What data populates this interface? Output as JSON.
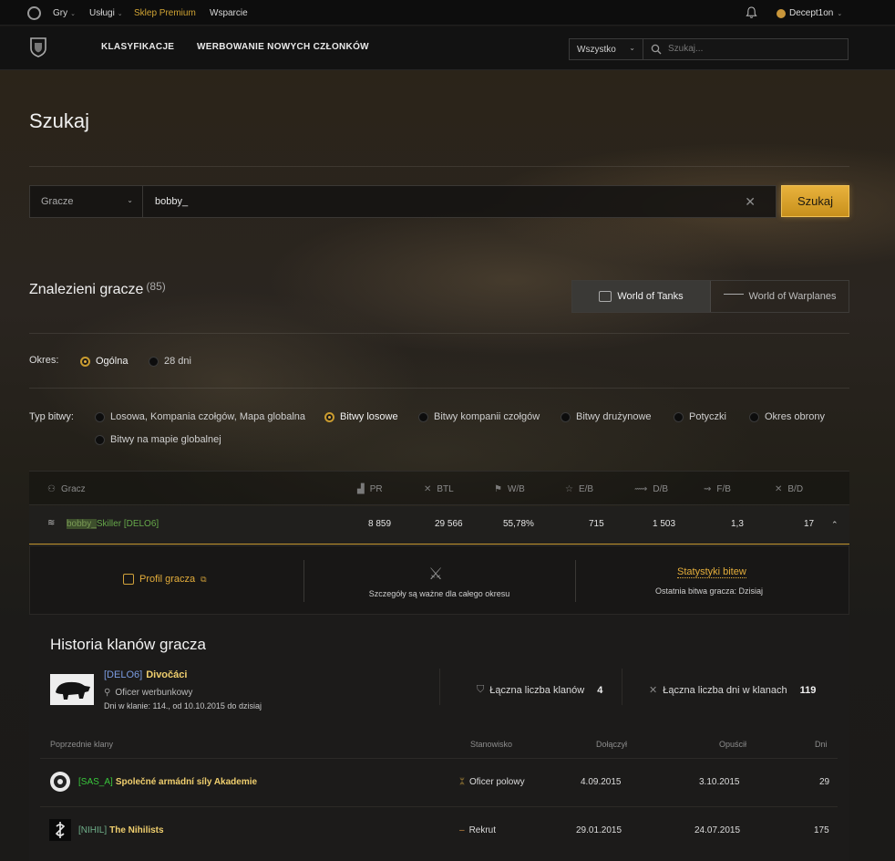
{
  "topbar": {
    "games": "Gry",
    "services": "Usługi",
    "premium": "Sklep Premium",
    "support": "Wsparcie",
    "username": "Decept1on"
  },
  "nav": {
    "rankings": "KLASYFIKACJE",
    "recruiting": "WERBOWANIE NOWYCH CZŁONKÓW",
    "scope_select": "Wszystko",
    "search_placeholder": "Szukaj..."
  },
  "page": {
    "title": "Szukaj",
    "search_type": "Gracze",
    "search_value": "bobby_",
    "search_button": "Szukaj"
  },
  "results": {
    "heading": "Znalezieni gracze",
    "count": "(85)",
    "game_tabs": [
      "World of Tanks",
      "World of Warplanes"
    ]
  },
  "filters": {
    "period_label": "Okres:",
    "period_options": [
      "Ogólna",
      "28 dni"
    ],
    "battle_type_label": "Typ bitwy:",
    "battle_types": [
      "Losowa, Kompania czołgów, Mapa globalna",
      "Bitwy losowe",
      "Bitwy kompanii czołgów",
      "Bitwy drużynowe",
      "Potyczki",
      "Okres obrony",
      "Bitwy na mapie globalnej"
    ]
  },
  "table": {
    "headers": [
      "Gracz",
      "PR",
      "BTL",
      "W/B",
      "E/B",
      "D/B",
      "F/B",
      "B/D"
    ],
    "row": {
      "name_highlight": "bobby_",
      "name_rest": "Skiller [DELO6]",
      "values": [
        "8 859",
        "29 566",
        "55,78%",
        "715",
        "1 503",
        "1,3",
        "17"
      ]
    }
  },
  "detail": {
    "profile_link": "Profil gracza",
    "note": "Szczegóły są ważne dla całego okresu",
    "stats_link": "Statystyki bitew",
    "last_battle": "Ostatnia bitwa gracza: Dzisiaj"
  },
  "clan_history": {
    "title": "Historia klanów gracza",
    "current": {
      "tag": "[DELO6]",
      "name": "Divočáci",
      "role": "Oficer werbunkowy",
      "since": "Dni w klanie: 114., od 10.10.2015 do dzisiaj"
    },
    "total_clans_label": "Łączna liczba klanów",
    "total_clans": "4",
    "total_days_label": "Łączna liczba dni w klanach",
    "total_days": "119",
    "columns": [
      "Poprzednie klany",
      "Stanowisko",
      "Dołączył",
      "Opuścił",
      "Dni"
    ],
    "rows": [
      {
        "tag": "[SAS_A]",
        "name": "Společné armádní síly Akademie",
        "role": "Oficer polowy",
        "joined": "4.09.2015",
        "left": "3.10.2015",
        "days": "29"
      },
      {
        "tag": "[NIHIL]",
        "name": "The Nihilists",
        "role": "Rekrut",
        "joined": "29.01.2015",
        "left": "24.07.2015",
        "days": "175"
      }
    ]
  },
  "colors": {
    "accent": "#e3ad3b",
    "premium": "#d1a434",
    "clan_tag": "#7a9be0",
    "player_name": "#66a84a"
  }
}
